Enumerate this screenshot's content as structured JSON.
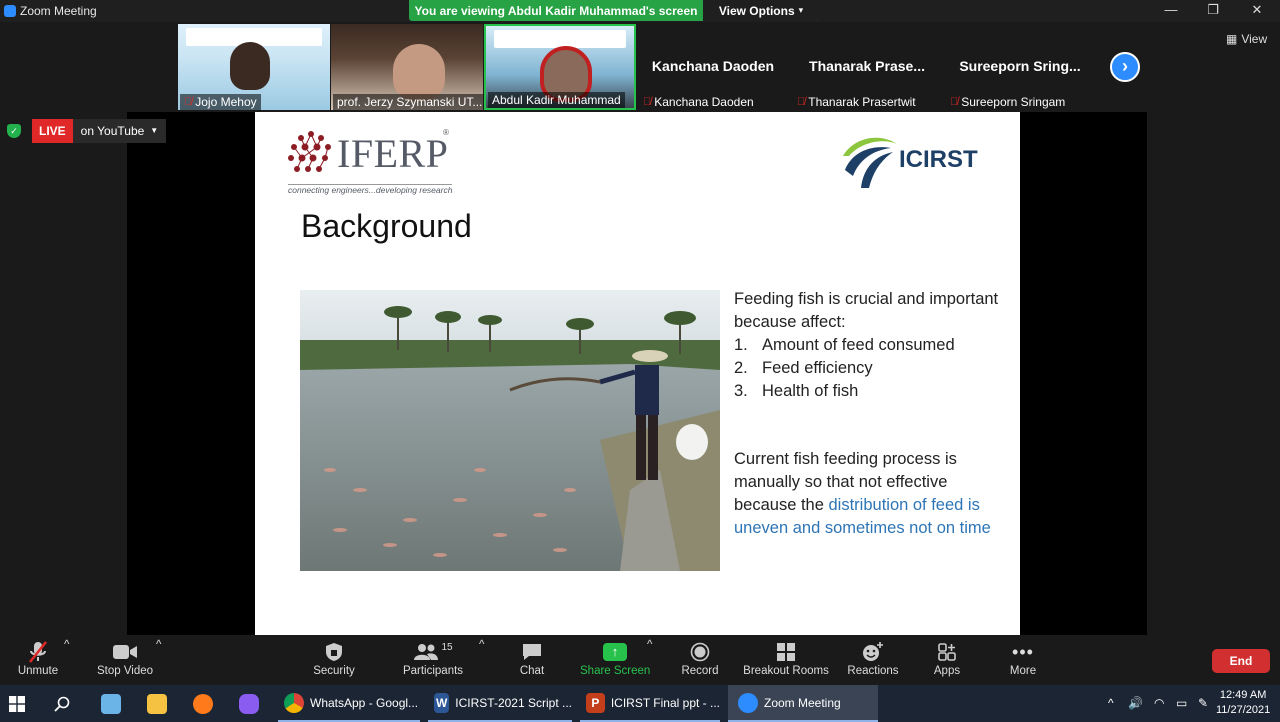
{
  "window": {
    "title": "Zoom Meeting",
    "share_banner": "You are viewing Abdul Kadir Muhammad's screen",
    "view_options": "View Options"
  },
  "participants": [
    {
      "name": "Jojo Mehoy",
      "type": "video",
      "muted": true
    },
    {
      "name": "prof. Jerzy Szymanski UT...",
      "type": "video",
      "muted": false
    },
    {
      "name": "Abdul Kadir Muhammad",
      "type": "video",
      "muted": false
    },
    {
      "display": "Kanchana Daoden",
      "name": "Kanchana Daoden",
      "type": "name",
      "muted": true
    },
    {
      "display": "Thanarak Prase...",
      "name": "Thanarak Prasertwit",
      "type": "name",
      "muted": true
    },
    {
      "display": "Sureeporn Sring...",
      "name": "Sureeporn Sringam",
      "type": "name",
      "muted": true
    }
  ],
  "view_label": "View",
  "live": {
    "tag": "LIVE",
    "platform": "on YouTube"
  },
  "slide": {
    "logo_left": "IFERP",
    "logo_left_reg": "®",
    "logo_left_tagline": "connecting engineers...developing research",
    "logo_right": "ICIRST",
    "title": "Background",
    "intro": "Feeding fish is crucial and important because affect:",
    "list": [
      {
        "num": "1.",
        "text": "Amount of feed consumed"
      },
      {
        "num": "2.",
        "text": "Feed efficiency"
      },
      {
        "num": "3.",
        "text": "Health of fish"
      }
    ],
    "para_plain": "Current fish feeding process is manually so that not effective because the ",
    "para_highlight": "distribution of feed is uneven and sometimes not on time",
    "highlight_color": "#2e75b6"
  },
  "toolbar": {
    "unmute": "Unmute",
    "stop_video": "Stop Video",
    "security": "Security",
    "participants": "Participants",
    "participants_count": "15",
    "chat": "Chat",
    "share_screen": "Share Screen",
    "record": "Record",
    "breakout_rooms": "Breakout Rooms",
    "reactions": "Reactions",
    "apps": "Apps",
    "more": "More",
    "end": "End"
  },
  "taskbar": {
    "items": [
      {
        "label": "WhatsApp - Googl..."
      },
      {
        "label": "ICIRST-2021 Script ..."
      },
      {
        "label": "ICIRST Final ppt - ..."
      },
      {
        "label": "Zoom Meeting"
      }
    ],
    "time": "12:49 AM",
    "date": "11/27/2021"
  },
  "colors": {
    "zoom_blue": "#2d8cff",
    "share_green": "#27a244",
    "live_red": "#e02828",
    "end_red": "#d23030"
  }
}
